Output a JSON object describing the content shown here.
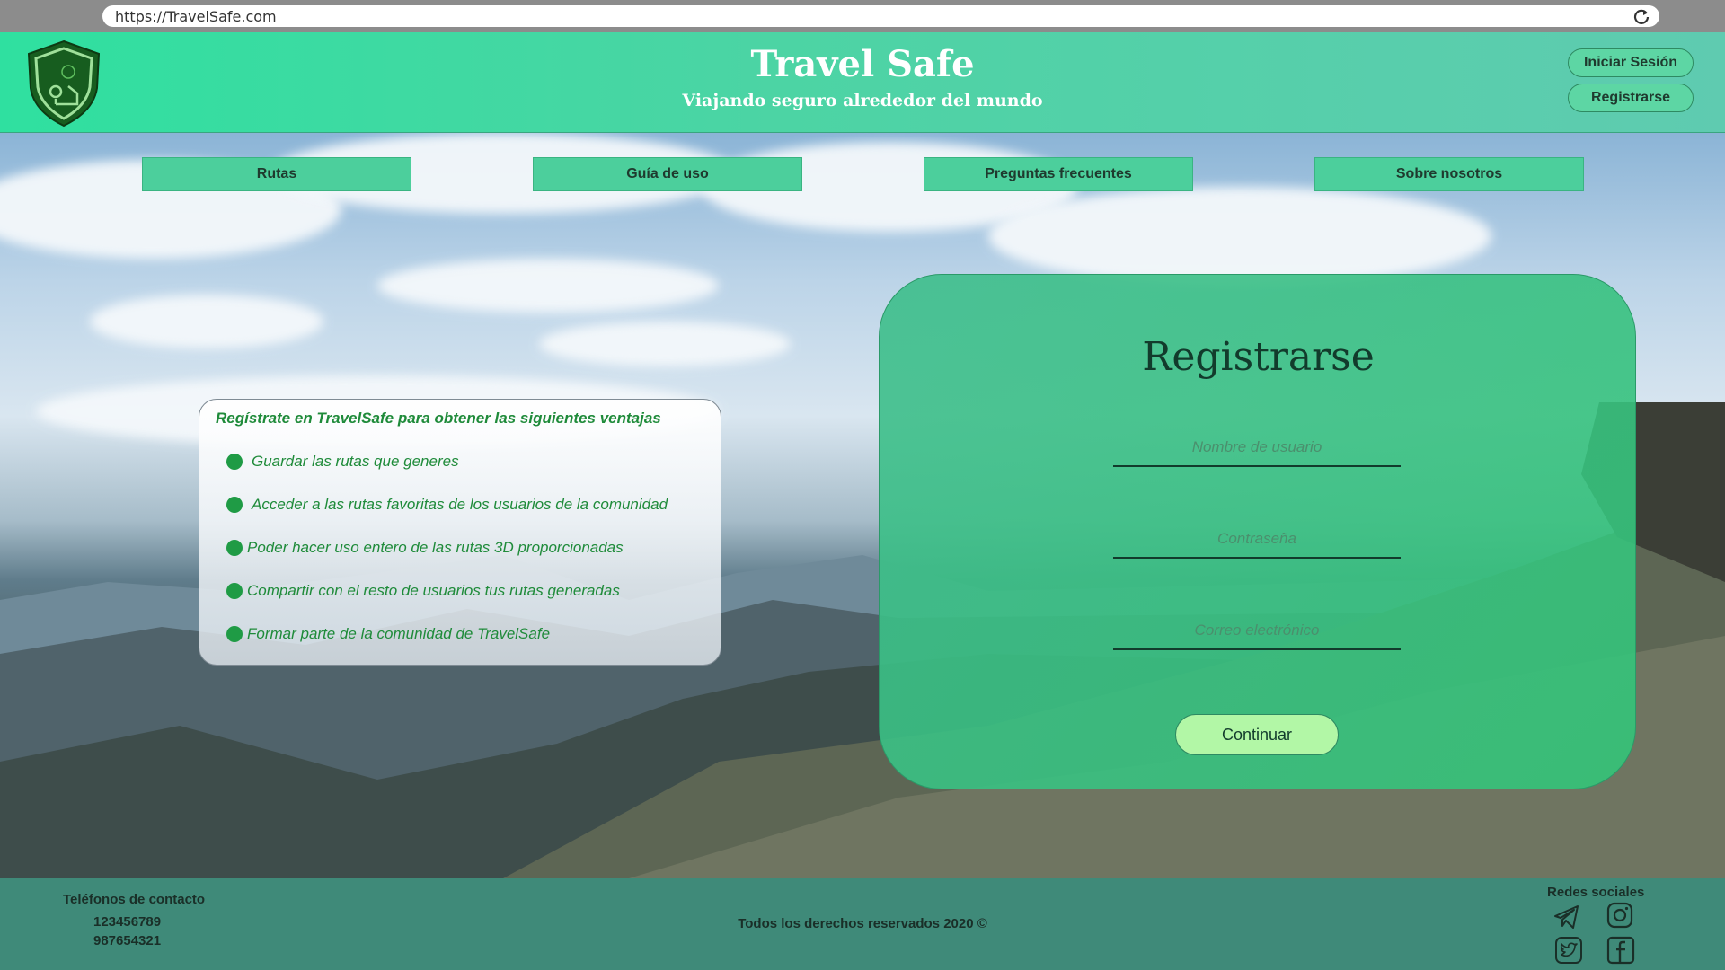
{
  "browser": {
    "url": "https://TravelSafe.com",
    "reload_icon": "reload-icon"
  },
  "header": {
    "logo_icon": "shield-logo-icon",
    "title": "Travel Safe",
    "subtitle": "Viajando seguro alrededor del mundo",
    "login_label": "Iniciar Sesión",
    "register_label": "Registrarse"
  },
  "nav": {
    "items": [
      {
        "label": "Rutas"
      },
      {
        "label": "Guía de uso"
      },
      {
        "label": "Preguntas frecuentes"
      },
      {
        "label": "Sobre nosotros"
      }
    ]
  },
  "info": {
    "heading": "Regístrate en TravelSafe para obtener las siguientes ventajas",
    "benefits": [
      "Guardar las rutas que generes",
      "Acceder a las rutas favoritas de los usuarios de la comunidad",
      "Poder hacer uso entero de las rutas 3D proporcionadas",
      "Compartir con el resto de usuarios tus rutas generadas",
      "Formar parte de la comunidad de TravelSafe"
    ]
  },
  "register": {
    "title": "Registrarse",
    "username_placeholder": "Nombre de usuario",
    "password_placeholder": "Contraseña",
    "email_placeholder": "Correo electrónico",
    "submit_label": "Continuar"
  },
  "footer": {
    "contact_title": "Teléfonos de contacto",
    "phones": [
      "123456789",
      "987654321"
    ],
    "copyright": "Todos los derechos reservados 2020 ©",
    "social_title": "Redes sociales",
    "social_icons": [
      "telegram-icon",
      "instagram-icon",
      "twitter-icon",
      "facebook-icon"
    ]
  },
  "colors": {
    "brand_green": "#4ccf9c",
    "text_green": "#1f8b3a",
    "footer": "#3f8a79",
    "submit": "#b2f7a6"
  }
}
